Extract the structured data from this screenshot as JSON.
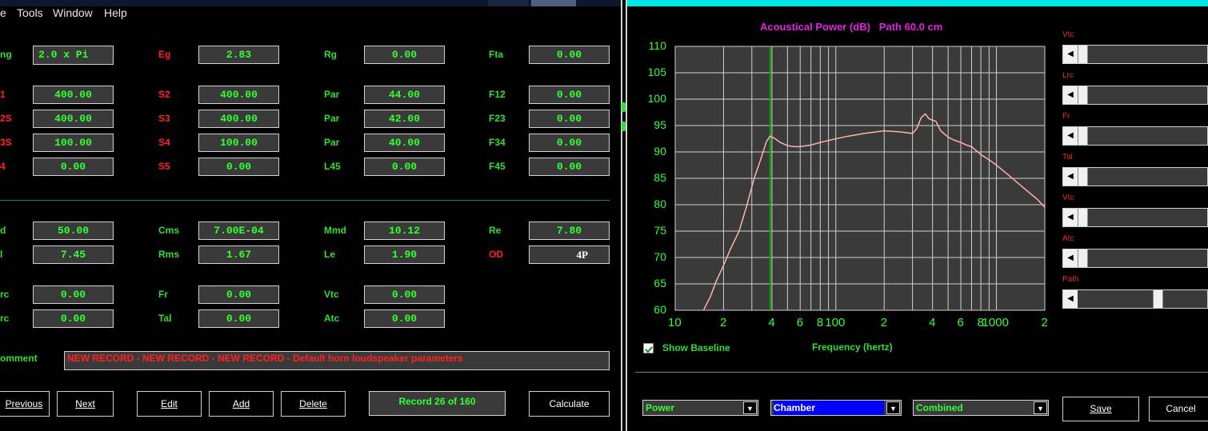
{
  "menu": [
    "e",
    "Tools",
    "Window",
    "Help"
  ],
  "form": {
    "labels": [
      "ng",
      "Eg",
      "Rg",
      "Fta",
      "1",
      "S2",
      "Par",
      "F12",
      "2S",
      "S3",
      "Par",
      "F23",
      "3S",
      "S4",
      "Par",
      "F34",
      "4",
      "S5",
      "L45",
      "F45",
      "d",
      "Cms",
      "Mmd",
      "Re",
      "l",
      "Rms",
      "Le",
      "OD",
      "rc",
      "Fr",
      "Vtc",
      "rc",
      "Tal",
      "Atc",
      "omment"
    ],
    "values": [
      "2.0 x Pi",
      "2.83",
      "0.00",
      "0.00",
      "400.00",
      "400.00",
      "44.00",
      "0.00",
      "400.00",
      "400.00",
      "42.00",
      "0.00",
      "100.00",
      "100.00",
      "40.00",
      "0.00",
      "0.00",
      "0.00",
      "0.00",
      "0.00",
      "50.00",
      "7.00E-04",
      "10.12",
      "7.80",
      "7.45",
      "1.67",
      "1.90",
      "4P",
      "0.00",
      "0.00",
      "0.00",
      "0.00",
      "0.00",
      "0.00"
    ],
    "comment": "NEW RECORD - NEW RECORD - NEW RECORD - Default horn loudspeaker parameters",
    "buttons": [
      "Previous",
      "Next",
      "Edit",
      "Add",
      "Delete",
      "Calculate"
    ],
    "record": "Record 26 of 160"
  },
  "graph": {
    "title": "Acoustical Power (dB)   Path 60.0 cm",
    "xlabel": "Frequency (hertz)",
    "show_baseline": "Show Baseline",
    "sliders": [
      "Vtc",
      "Lrc",
      "Fr",
      "Tal",
      "Vtc",
      "Atc",
      "Path"
    ],
    "dropdowns": [
      "Power",
      "Chamber",
      "Combined"
    ],
    "buttons": [
      "Save",
      "Cancel"
    ]
  },
  "chart_data": {
    "type": "line",
    "title": "Acoustical Power (dB)   Path 60.0 cm",
    "xlabel": "Frequency (hertz)",
    "ylabel": "",
    "x_scale": "log",
    "xlim": [
      10,
      2000
    ],
    "ylim": [
      60,
      110
    ],
    "yticks": [
      "110",
      "105",
      "100",
      "95",
      "90",
      "85",
      "80",
      "75",
      "70",
      "65",
      "60"
    ],
    "xticks": [
      "10",
      "2",
      "4",
      "6",
      "8",
      "100",
      "2",
      "4",
      "6",
      "8",
      "1000",
      "2"
    ],
    "grid": true,
    "marker_x": 39,
    "series": [
      {
        "color": "#ffb0b0",
        "x": [
          15,
          16.5,
          18,
          20,
          22,
          25,
          28,
          31,
          34,
          37,
          39,
          42,
          45,
          50,
          55,
          60,
          70,
          80,
          100,
          120,
          150,
          200,
          250,
          300,
          320,
          340,
          360,
          380,
          400,
          420,
          450,
          500,
          550,
          600,
          650,
          700,
          800,
          900,
          1000,
          1200,
          1500,
          1800,
          2000
        ],
        "y": [
          60,
          62.5,
          65.5,
          68.5,
          71.5,
          75,
          80,
          85,
          88.5,
          92,
          93,
          92.5,
          91.8,
          91.2,
          91,
          91,
          91.3,
          91.8,
          92.5,
          93,
          93.5,
          94,
          93.8,
          93.5,
          94.5,
          96.5,
          97.2,
          96.3,
          96,
          95.8,
          94,
          92.8,
          92.2,
          91.8,
          91.3,
          91,
          89.5,
          88.5,
          87.5,
          85.5,
          83,
          81,
          79.5
        ]
      }
    ]
  }
}
